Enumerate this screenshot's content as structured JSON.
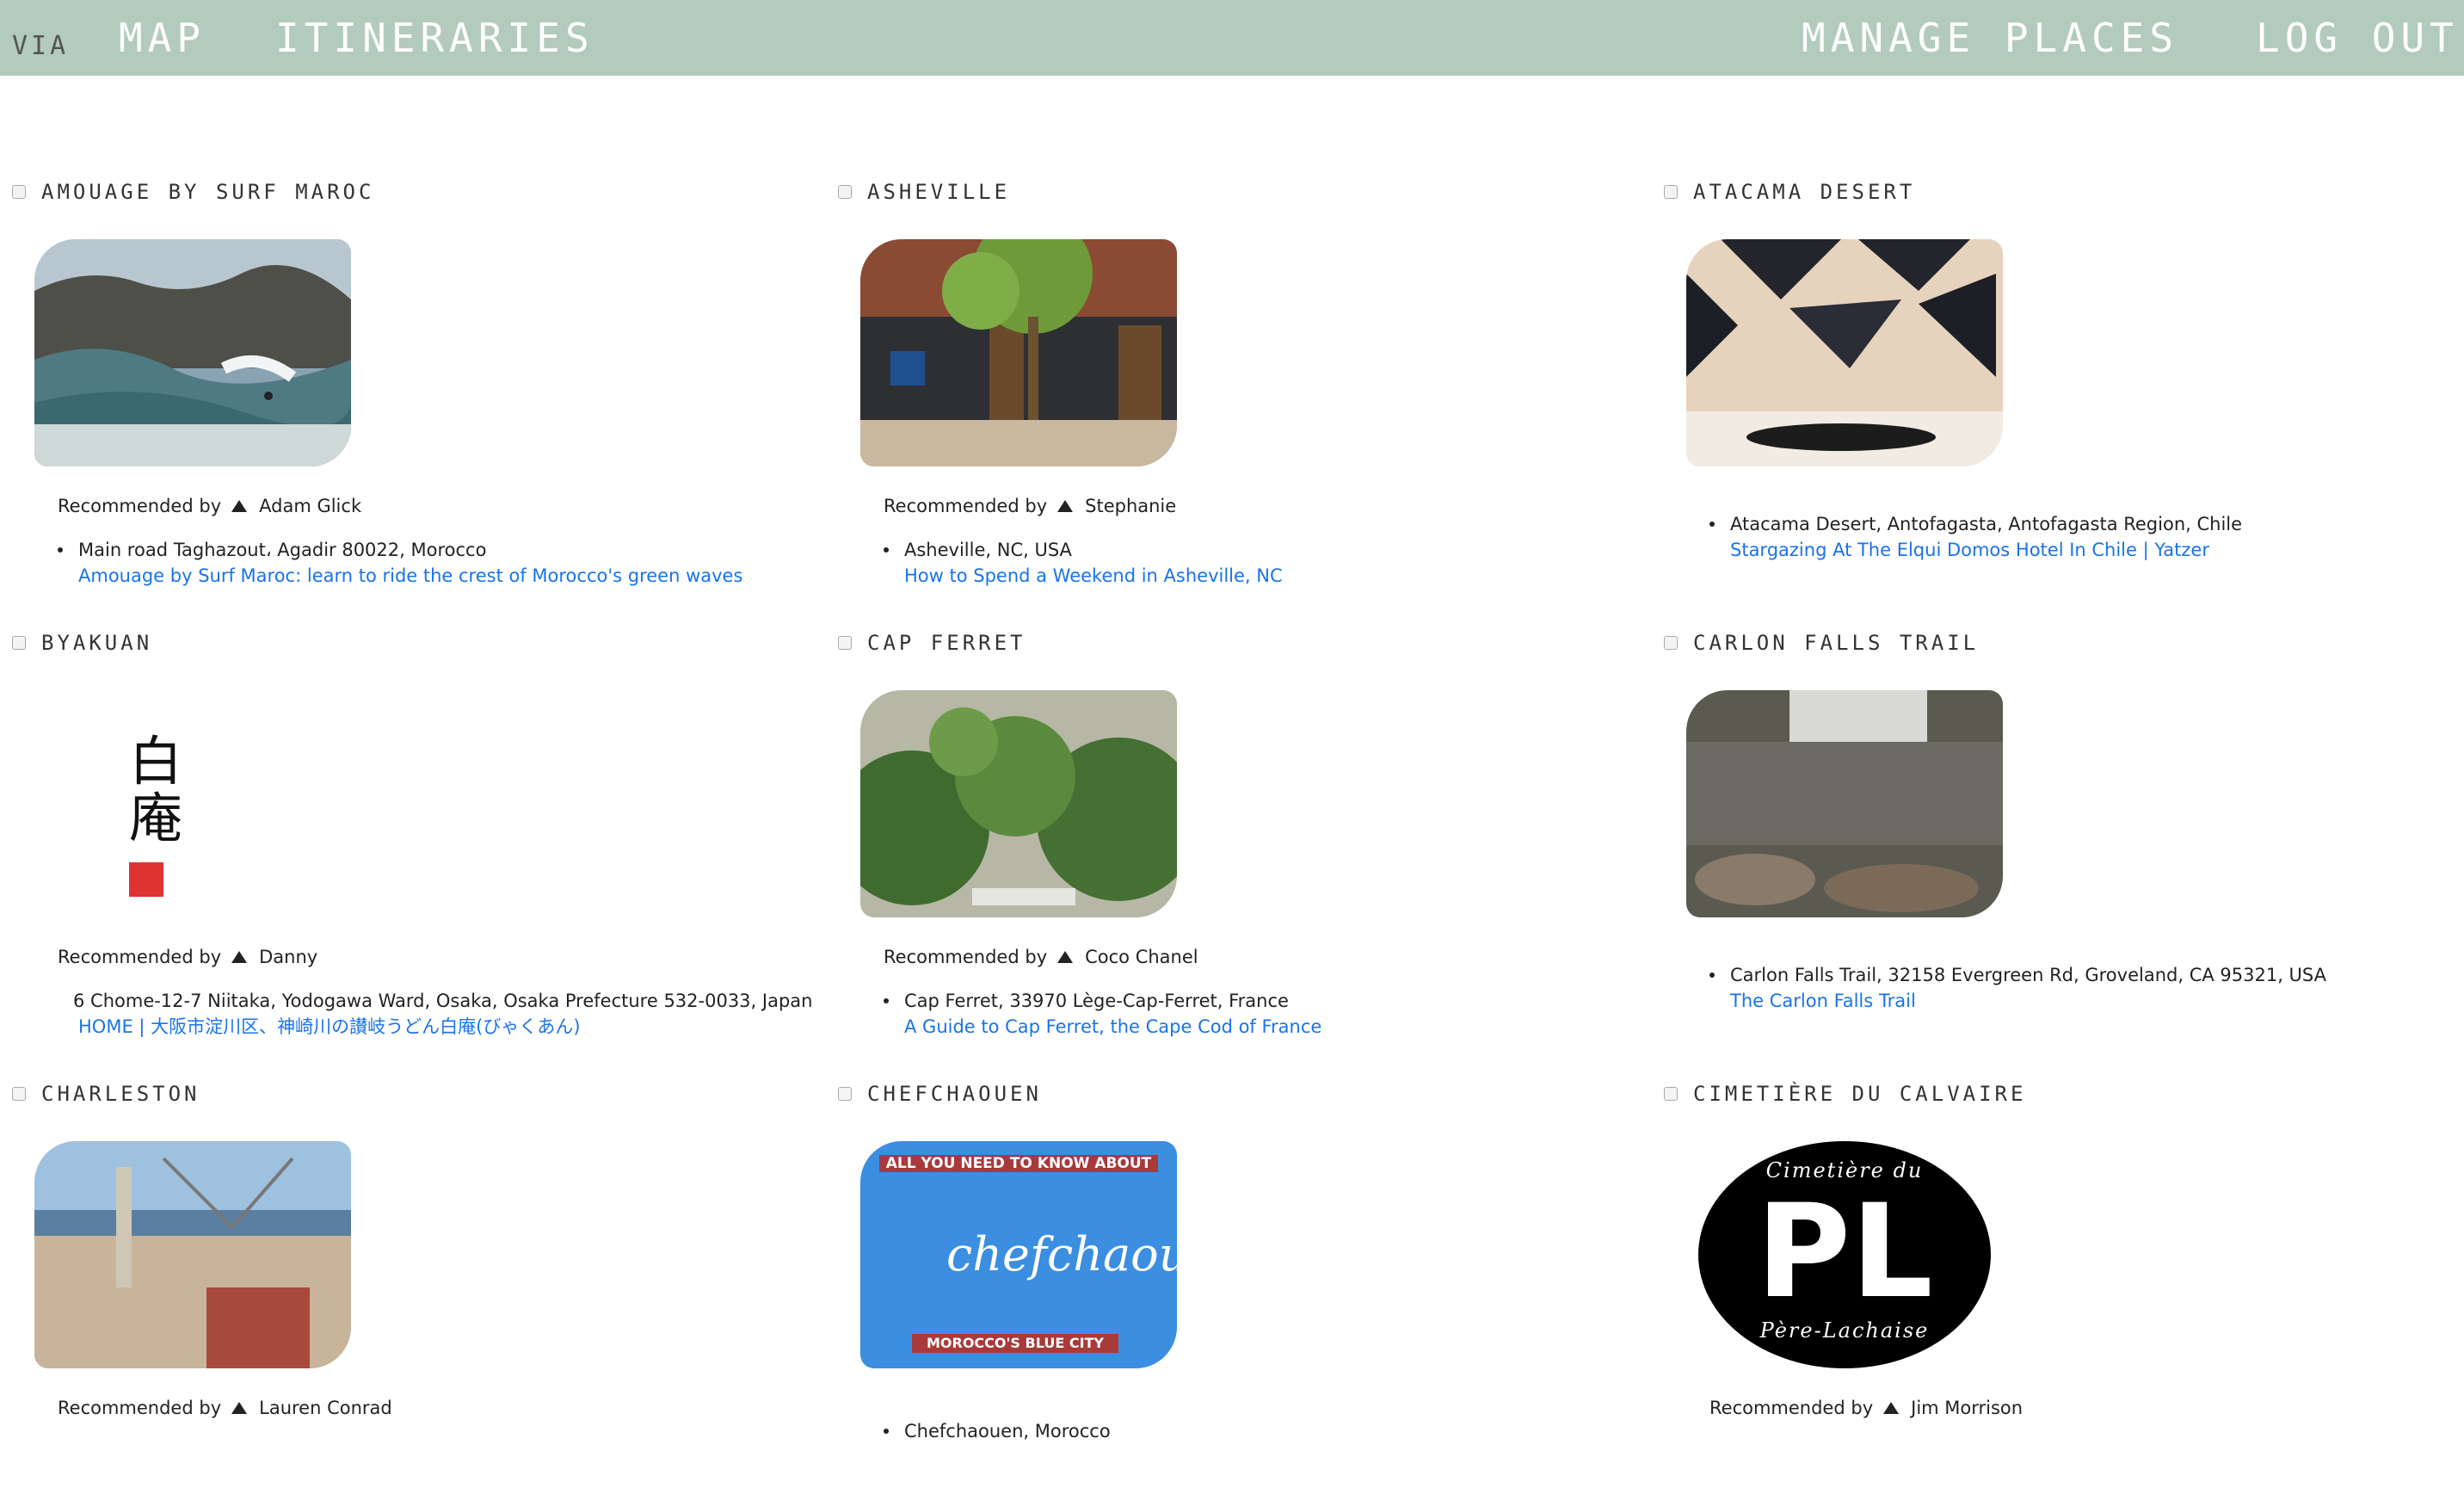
{
  "nav": {
    "brand": "VIA",
    "map": "MAP",
    "itineraries": "ITINERARIES",
    "manage": "MANAGE PLACES",
    "logout": "LOG OUT"
  },
  "rec_label": "Recommended by",
  "places": [
    {
      "title": "Amouage by Surf Maroc",
      "recommender": "Adam Glick",
      "address": "Main road Taghazout، Agadir 80022, Morocco",
      "link": "Amouage by Surf Maroc: learn to ride the crest of Morocco's green waves"
    },
    {
      "title": "Asheville",
      "recommender": "Stephanie",
      "address": "Asheville, NC, USA",
      "link": "How to Spend a Weekend in Asheville, NC"
    },
    {
      "title": "Atacama Desert",
      "recommender": "",
      "address": "Atacama Desert, Antofagasta, Antofagasta Region, Chile",
      "link": "Stargazing At The Elqui Domos Hotel In Chile | Yatzer"
    },
    {
      "title": "Byakuan",
      "recommender": "Danny",
      "address": "6 Chome-12-7 Niitaka, Yodogawa Ward, Osaka, Osaka Prefecture 532-0033, Japan",
      "link": "HOME | 大阪市淀川区、神崎川の讃岐うどん白庵(びゃくあん)",
      "logo_text": "白庵"
    },
    {
      "title": "Cap Ferret",
      "recommender": "Coco Chanel",
      "address": "Cap Ferret, 33970 Lège-Cap-Ferret, France",
      "link": "A Guide to Cap Ferret, the Cape Cod of France"
    },
    {
      "title": "Carlon Falls Trail",
      "recommender": "",
      "address": "Carlon Falls Trail, 32158 Evergreen Rd, Groveland, CA 95321, USA",
      "link": "The Carlon Falls Trail"
    },
    {
      "title": "Charleston",
      "recommender": "Lauren Conrad",
      "address": "",
      "link": ""
    },
    {
      "title": "Chefchaouen",
      "recommender": "",
      "address": "Chefchaouen, Morocco",
      "link": "",
      "banner_top": "ALL YOU NEED TO KNOW ABOUT",
      "banner_word": "chefchaouen",
      "banner_bottom": "MOROCCO'S BLUE CITY"
    },
    {
      "title": "Cimetière du Calvaire",
      "recommender": "Jim Morrison",
      "address": "",
      "link": "",
      "logo_top": "Cimetière du",
      "logo_mid": "PL",
      "logo_bottom": "Père-Lachaise"
    }
  ]
}
